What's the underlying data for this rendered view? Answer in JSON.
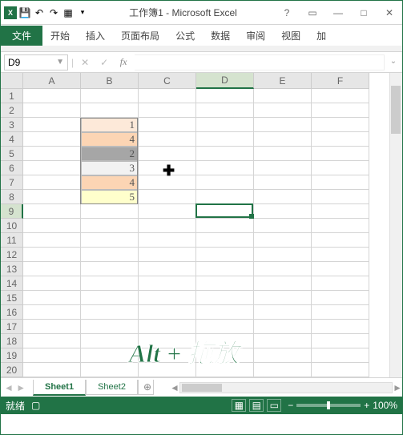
{
  "titlebar": {
    "app_icon": "X",
    "title": "工作簿1 - Microsoft Excel",
    "help": "?",
    "restore_small": "▭",
    "min": "—",
    "max": "□",
    "close": "✕"
  },
  "qat": {
    "save": "💾",
    "undo": "↶",
    "redo": "↷",
    "table": "▦",
    "more": "▾"
  },
  "ribbon": {
    "file": "文件",
    "tabs": [
      "开始",
      "插入",
      "页面布局",
      "公式",
      "数据",
      "审阅",
      "视图",
      "加"
    ]
  },
  "formula_bar": {
    "namebox": "D9",
    "cancel": "✕",
    "enter": "✓",
    "fx": "fx",
    "value": ""
  },
  "grid": {
    "cols": [
      "A",
      "B",
      "C",
      "D",
      "E",
      "F"
    ],
    "rows": 20,
    "sel_col": 3,
    "sel_row": 9,
    "data": {
      "B3": {
        "v": "1",
        "bg": "#fde9d9"
      },
      "B4": {
        "v": "4",
        "bg": "#fcd5b4"
      },
      "B5": {
        "v": "2",
        "bg": "#a6a6a6"
      },
      "B6": {
        "v": "3",
        "bg": "#f2f2f2"
      },
      "B7": {
        "v": "4",
        "bg": "#fcd5b4"
      },
      "B8": {
        "v": "5",
        "bg": "#ffffcc"
      }
    },
    "cursor": {
      "col": "C",
      "row": 6,
      "glyph": "✚"
    }
  },
  "overlay": "Alt + 拖放",
  "sheets": {
    "tabs": [
      {
        "name": "Sheet1",
        "active": true
      },
      {
        "name": "Sheet2",
        "active": false
      }
    ],
    "add": "⊕"
  },
  "status": {
    "ready": "就绪",
    "rec": "▢",
    "zoom_pct": "100%",
    "zoom_minus": "−",
    "zoom_plus": "+"
  }
}
